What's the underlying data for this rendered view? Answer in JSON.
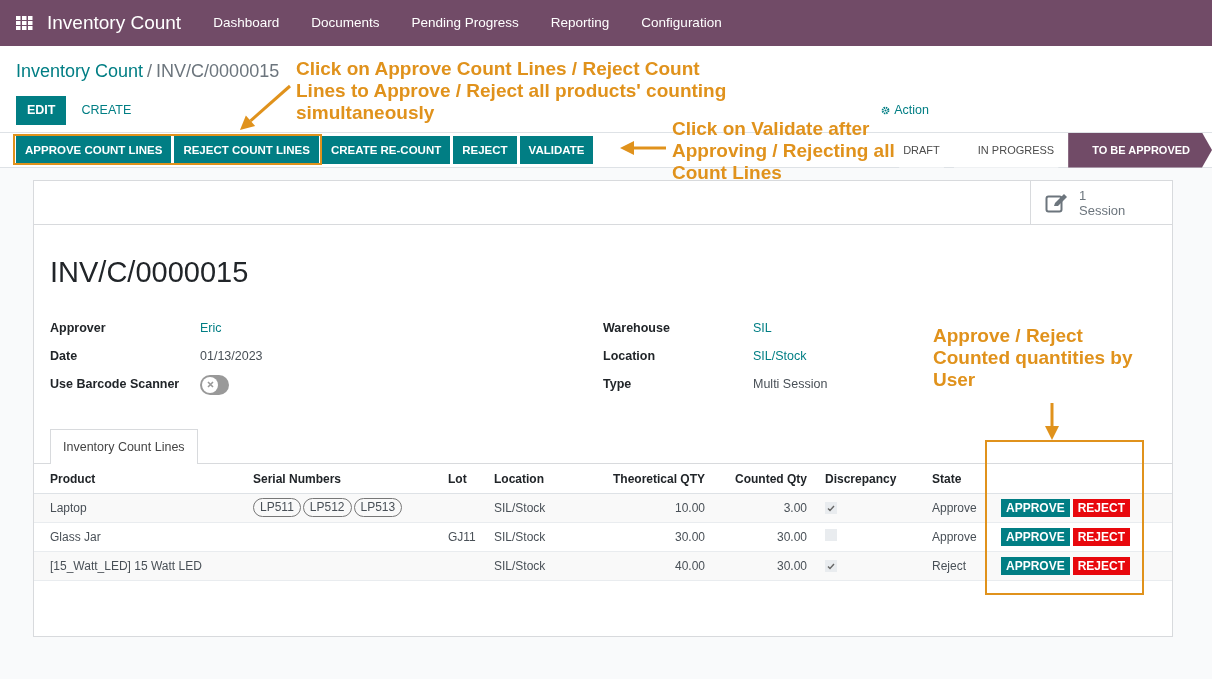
{
  "navbar": {
    "app_title": "Inventory Count",
    "menu": [
      "Dashboard",
      "Documents",
      "Pending Progress",
      "Reporting",
      "Configuration"
    ]
  },
  "breadcrumb": {
    "parent": "Inventory Count",
    "separator": "/",
    "current": "INV/C/0000015"
  },
  "control_panel": {
    "edit": "EDIT",
    "create": "CREATE",
    "action": "Action"
  },
  "header_buttons": [
    "APPROVE COUNT LINES",
    "REJECT COUNT LINES",
    "CREATE RE-COUNT",
    "REJECT",
    "VALIDATE"
  ],
  "status_steps": [
    {
      "label": "DRAFT",
      "selected": false
    },
    {
      "label": "IN PROGRESS",
      "selected": false
    },
    {
      "label": "TO BE APPROVED",
      "selected": true
    }
  ],
  "smart_button": {
    "count": "1",
    "label": "Session"
  },
  "record_title": "INV/C/0000015",
  "fields_left": [
    {
      "label": "Approver",
      "value": "Eric",
      "kind": "link"
    },
    {
      "label": "Date",
      "value": "01/13/2023",
      "kind": "text"
    },
    {
      "label": "Use Barcode Scanner",
      "kind": "toggle",
      "on": false
    }
  ],
  "fields_right": [
    {
      "label": "Warehouse",
      "value": "SIL",
      "kind": "link"
    },
    {
      "label": "Location",
      "value": "SIL/Stock",
      "kind": "link"
    },
    {
      "label": "Type",
      "value": "Multi Session",
      "kind": "text"
    }
  ],
  "tabs": [
    {
      "label": "Inventory Count Lines",
      "selected": true
    }
  ],
  "table": {
    "columns": [
      "Product",
      "Serial Numbers",
      "Lot",
      "Location",
      "Theoretical QTY",
      "Counted Qty",
      "Discrepancy",
      "State"
    ],
    "rows": [
      {
        "product": "Laptop",
        "serials": [
          "LP511",
          "LP512",
          "LP513"
        ],
        "lot": "",
        "location": "SIL/Stock",
        "theoretical": "10.00",
        "counted": "3.00",
        "discrepancy": true,
        "state": "Approve",
        "approve": "APPROVE",
        "reject": "REJECT"
      },
      {
        "product": "Glass Jar",
        "serials": [],
        "lot": "GJ11",
        "location": "SIL/Stock",
        "theoretical": "30.00",
        "counted": "30.00",
        "discrepancy": false,
        "state": "Approve",
        "approve": "APPROVE",
        "reject": "REJECT"
      },
      {
        "product": "[15_Watt_LED] 15 Watt LED",
        "serials": [],
        "lot": "",
        "location": "SIL/Stock",
        "theoretical": "40.00",
        "counted": "30.00",
        "discrepancy": true,
        "state": "Reject",
        "approve": "APPROVE",
        "reject": "REJECT"
      }
    ]
  },
  "annotations": [
    {
      "text": "Click on Approve Count Lines / Reject Count Lines to Approve / Reject all products' counting simultaneously"
    },
    {
      "text": "Click on Validate after Approving / Rejecting all Count Lines"
    },
    {
      "text": "Approve / Reject Counted quantities by User"
    }
  ]
}
